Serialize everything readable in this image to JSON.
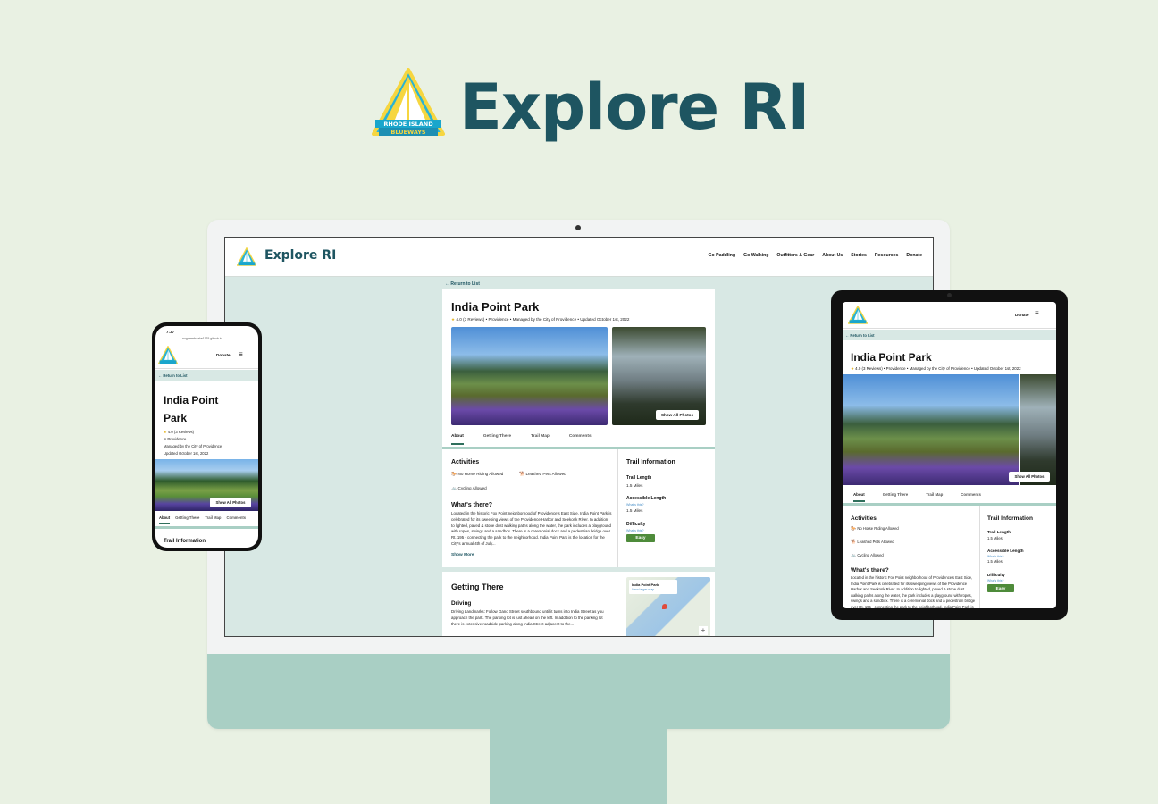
{
  "hero": {
    "title": "Explore RI",
    "logo_text_top": "RHODE ISLAND",
    "logo_text_bottom": "BLUEWAYS"
  },
  "site": {
    "brand": "Explore RI",
    "nav": [
      "Go Paddling",
      "Go Walking",
      "Outfitters & Gear",
      "About Us",
      "Stories",
      "Resources",
      "Donate"
    ],
    "mobile_nav_label": "Donate",
    "return_label": "← Return to List"
  },
  "park": {
    "name": "India Point Park",
    "mobile_name_line1": "India Point",
    "mobile_name_line2": "Park",
    "rating": "4.0 (3 Reviews)",
    "city": "Providence",
    "city_mobile": "in Providence",
    "manager": "Managed by the City of Providence",
    "updated": "Updated October 1st, 2022",
    "meta_line": "4.0 (3 Reviews) • Providence • Managed by the City of Providence • Updated October 1st, 2022",
    "show_photos": "Show All Photos"
  },
  "tabs": [
    "About",
    "Getting There",
    "Trail Map",
    "Comments"
  ],
  "activities": {
    "heading": "Activities",
    "items": [
      {
        "label": "No Horse Riding Allowed",
        "icon": "horse-icon"
      },
      {
        "label": "Leashed Pets Allowed",
        "icon": "dog-icon"
      },
      {
        "label": "Cycling Allowed",
        "icon": "bicycle-icon"
      }
    ]
  },
  "whats_there": {
    "heading": "What's there?",
    "body": "Located in the historic Fox Point neighborhood of Providence's East Side, India Point Park is celebrated for its sweeping views of the Providence Harbor and Seekonk River. In addition to lighted, paved & stone dust walking paths along the water, the park includes a playground with ropes, swings and a sandbox. There is a ceremonial dock and a pedestrian bridge over Rt. 195 - connecting the park to the neighborhood. India Point Park is the location for the City's annual 4th of July...",
    "show_more": "Show More"
  },
  "trail_info": {
    "heading": "Trail Information",
    "length_label": "Trail Length",
    "length_value": "1.5 Miles",
    "accessible_label": "Accessible Length",
    "accessible_link": "What's this?",
    "accessible_value": "1.5 Miles",
    "difficulty_label": "Difficulty",
    "difficulty_link": "What's this?",
    "difficulty_value": "Easy"
  },
  "getting_there": {
    "heading": "Getting There",
    "driving_heading": "Driving",
    "driving_body": "Driving Landmarks: Follow Gano Street southbound until it turns into India Street as you approach the park. The parking lot is just ahead on the left. In addition to the parking lot there is extensive roadside parking along India Street adjacent to the...",
    "map_title": "India Point Park",
    "map_link": "View larger map"
  },
  "phone": {
    "time": "7:37",
    "url": "nogarrerbaake1125.github.io",
    "trail_info_heading": "Trail Information"
  },
  "colors": {
    "brand": "#1e5561",
    "accent": "#4e8b3a",
    "chin": "#a9cfc4",
    "background": "#e9f1e3"
  }
}
